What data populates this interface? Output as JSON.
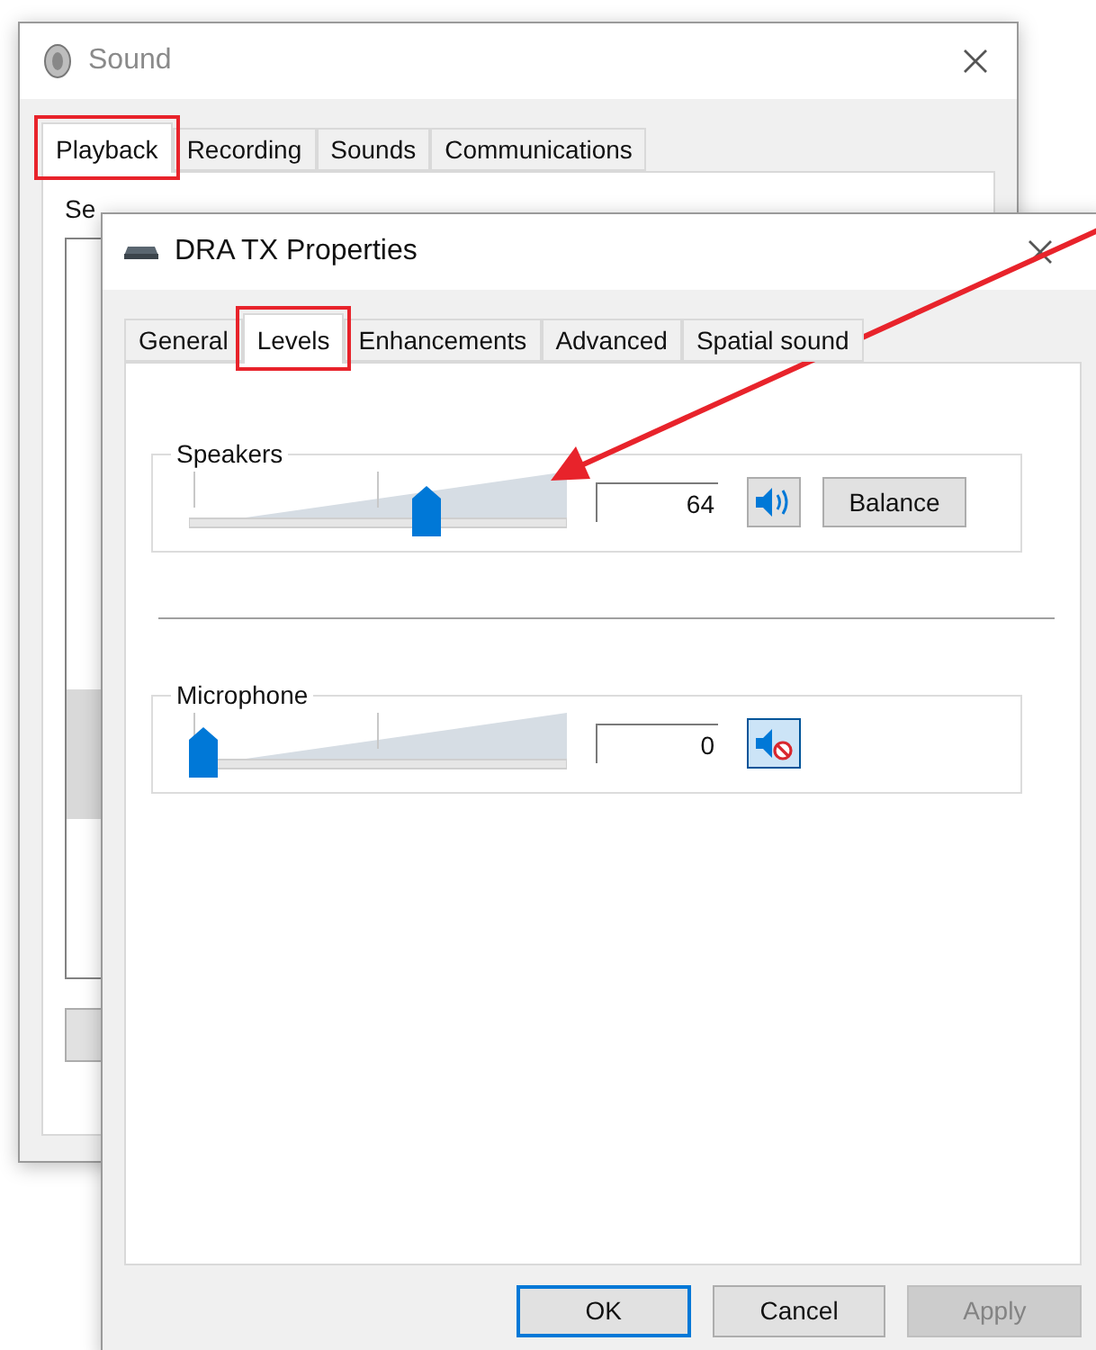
{
  "back_window": {
    "title": "Sound",
    "tabs": [
      {
        "label": "Playback",
        "selected": true,
        "highlighted": true
      },
      {
        "label": "Recording",
        "selected": false,
        "highlighted": false
      },
      {
        "label": "Sounds",
        "selected": false,
        "highlighted": false
      },
      {
        "label": "Communications",
        "selected": false,
        "highlighted": false
      }
    ],
    "instruction": "Se"
  },
  "dialog": {
    "title": "DRA TX Properties",
    "tabs": [
      {
        "label": "General",
        "selected": false,
        "highlighted": false
      },
      {
        "label": "Levels",
        "selected": true,
        "highlighted": true
      },
      {
        "label": "Enhancements",
        "selected": false,
        "highlighted": false
      },
      {
        "label": "Advanced",
        "selected": false,
        "highlighted": false
      },
      {
        "label": "Spatial sound",
        "selected": false,
        "highlighted": false
      }
    ],
    "channels": [
      {
        "name": "Speakers",
        "level": 0.64,
        "reading": "64",
        "muted": false,
        "balance_button": "Balance"
      },
      {
        "name": "Microphone",
        "level": 0,
        "reading": "0",
        "muted": true
      }
    ],
    "buttons": [
      {
        "label": "OK",
        "kind": "default",
        "disabled": false
      },
      {
        "label": "Cancel",
        "kind": "normal",
        "disabled": false
      },
      {
        "label": "Apply",
        "kind": "normal",
        "disabled": true
      }
    ]
  }
}
